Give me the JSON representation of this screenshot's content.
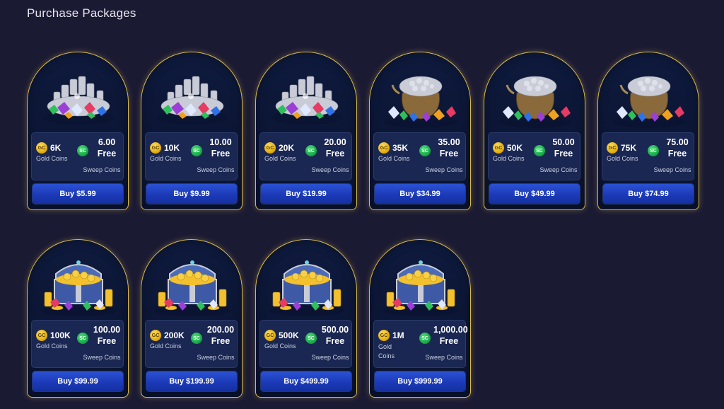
{
  "page": {
    "title": "Purchase Packages"
  },
  "icons": {
    "gold_coin": "GC",
    "sweep_coin": "SC"
  },
  "labels": {
    "gold_coins": "Gold Coins",
    "sweep_coins": "Sweep Coins",
    "free": "Free"
  },
  "colors": {
    "background": "#1b1a33",
    "card_border": "#d9b94a",
    "buy_button": "#1c3ab8",
    "gold_badge": "#e0a800",
    "sweep_badge": "#15a244"
  },
  "packages": [
    {
      "art": "gem-pile-icon",
      "gold": "6K",
      "sweep": "6.00",
      "buy": "Buy $5.99"
    },
    {
      "art": "gem-pile-icon",
      "gold": "10K",
      "sweep": "10.00",
      "buy": "Buy $9.99"
    },
    {
      "art": "gem-pile-icon",
      "gold": "20K",
      "sweep": "20.00",
      "buy": "Buy $19.99"
    },
    {
      "art": "treasure-sack-icon",
      "gold": "35K",
      "sweep": "35.00",
      "buy": "Buy $34.99"
    },
    {
      "art": "treasure-sack-icon",
      "gold": "50K",
      "sweep": "50.00",
      "buy": "Buy $49.99"
    },
    {
      "art": "treasure-sack-icon",
      "gold": "75K",
      "sweep": "75.00",
      "buy": "Buy $74.99"
    },
    {
      "art": "treasure-chest-icon",
      "gold": "100K",
      "sweep": "100.00",
      "buy": "Buy $99.99"
    },
    {
      "art": "treasure-chest-icon",
      "gold": "200K",
      "sweep": "200.00",
      "buy": "Buy $199.99"
    },
    {
      "art": "treasure-chest-icon",
      "gold": "500K",
      "sweep": "500.00",
      "buy": "Buy $499.99"
    },
    {
      "art": "treasure-chest-icon",
      "gold": "1M",
      "sweep": "1,000.00",
      "buy": "Buy $999.99"
    }
  ]
}
